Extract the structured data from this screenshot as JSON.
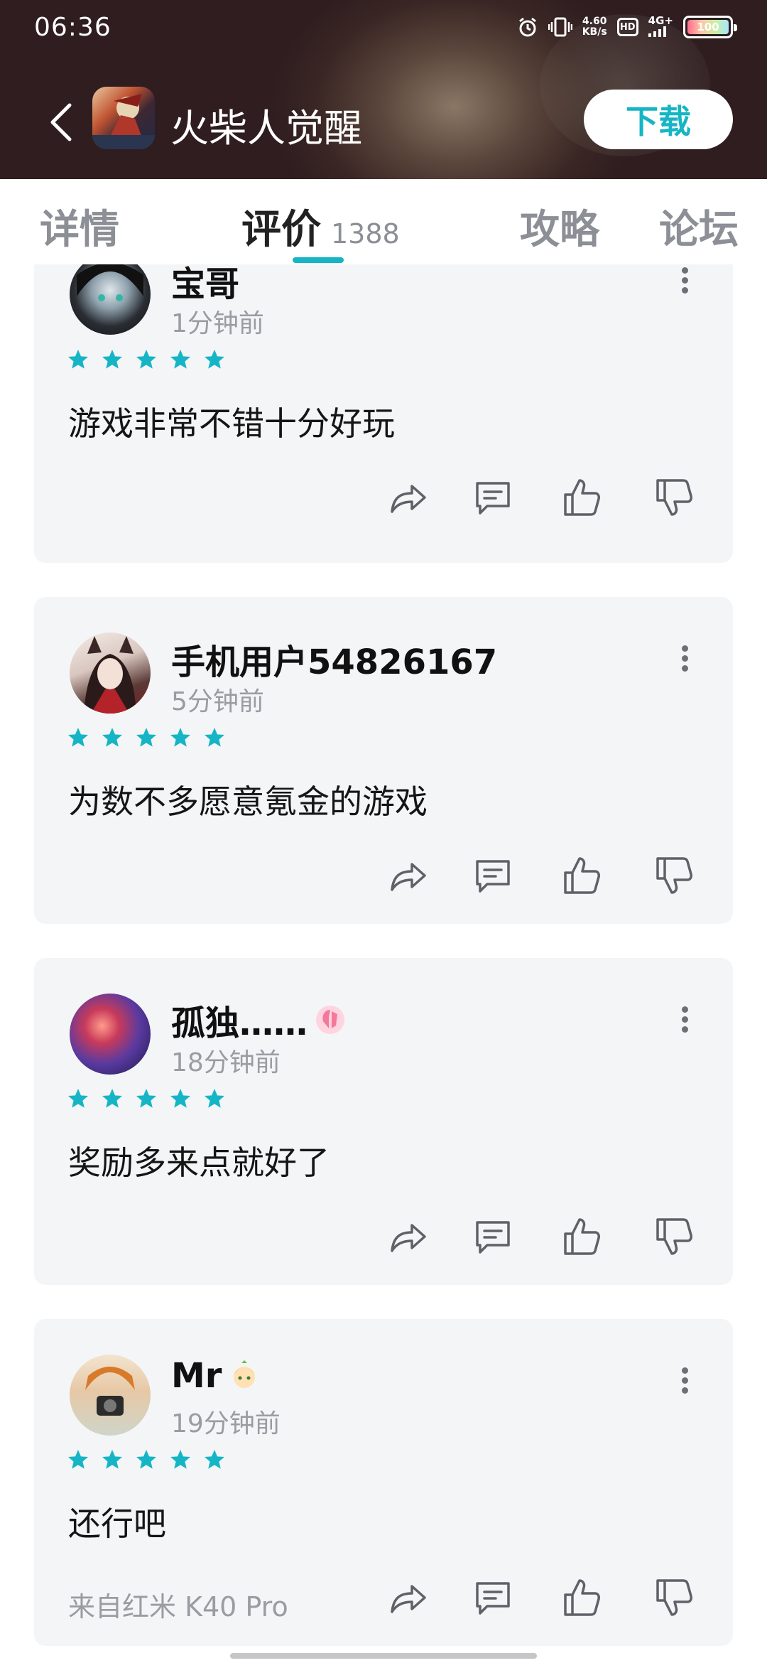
{
  "status_bar": {
    "time": "06:36",
    "net_speed_value": "4.60",
    "net_speed_unit": "KB/s",
    "hd_label": "HD",
    "signal_label": "4G+",
    "battery_level": "100"
  },
  "app_header": {
    "title": "火柴人觉醒",
    "download_label": "下载",
    "accent_color": "#16b5c5"
  },
  "tabs": [
    {
      "label": "详情"
    },
    {
      "label": "评价",
      "count": "1388",
      "active": true
    },
    {
      "label": "攻略"
    },
    {
      "label": "论坛"
    }
  ],
  "reviews": [
    {
      "username": "宝哥",
      "time": "1分钟前",
      "stars": 5,
      "content": "游戏非常不错十分好玩"
    },
    {
      "username": "手机用户54826167",
      "time": "5分钟前",
      "stars": 5,
      "content": "为数不多愿意氪金的游戏"
    },
    {
      "username": "孤独……",
      "time": "18分钟前",
      "stars": 5,
      "content": "奖励多来点就好了"
    },
    {
      "username": "Mr",
      "time": "19分钟前",
      "stars": 5,
      "content": "还行吧",
      "device": "来自红米 K40 Pro"
    }
  ]
}
